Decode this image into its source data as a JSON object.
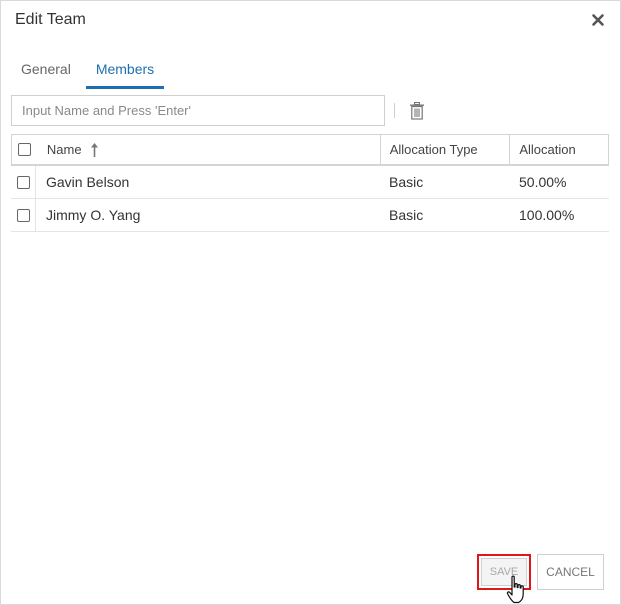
{
  "dialog": {
    "title": "Edit Team",
    "close_icon": "close-icon"
  },
  "tabs": [
    {
      "label": "General",
      "active": false
    },
    {
      "label": "Members",
      "active": true
    }
  ],
  "search": {
    "placeholder": "Input Name and Press 'Enter'",
    "value": ""
  },
  "toolbar": {
    "delete_icon": "trash-icon"
  },
  "table": {
    "columns": [
      "Name",
      "Allocation Type",
      "Allocation"
    ],
    "sort": {
      "column": "Name",
      "direction": "ascending",
      "icon": "sort-up-arrow-icon"
    },
    "rows": [
      {
        "name": "Gavin Belson",
        "type": "Basic",
        "allocation": "50.00%",
        "checked": false
      },
      {
        "name": "Jimmy O. Yang",
        "type": "Basic",
        "allocation": "100.00%",
        "checked": false
      }
    ]
  },
  "footer": {
    "save_label": "SAVE",
    "cancel_label": "CANCEL"
  },
  "colors": {
    "accent": "#1f6fb0",
    "highlight": "#e0161b"
  }
}
